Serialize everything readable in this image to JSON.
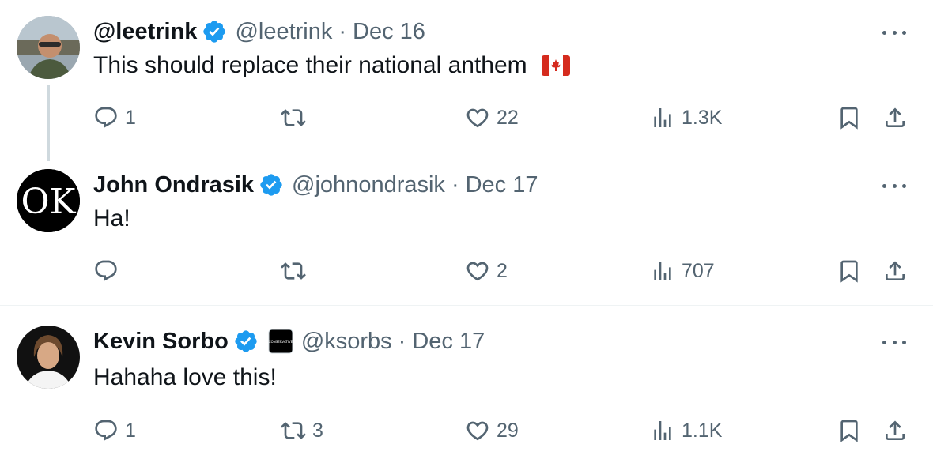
{
  "tweets": [
    {
      "name": "@leetrink",
      "handle": "@leetrink",
      "date": "Dec 16",
      "text": "This should replace their national anthem",
      "flag_icon": "canada-flag-icon",
      "replies": "1",
      "retweets": "",
      "likes": "22",
      "views": "1.3K"
    },
    {
      "name": "John Ondrasik",
      "handle": "@johnondrasik",
      "date": "Dec 17",
      "text": "Ha!",
      "avatar_text": "OK",
      "replies": "",
      "retweets": "",
      "likes": "2",
      "views": "707"
    },
    {
      "name": "Kevin Sorbo",
      "handle": "@ksorbs",
      "date": "Dec 17",
      "text": "Hahaha love this!",
      "affiliate_badge": "CONSERVATIVE",
      "replies": "1",
      "retweets": "3",
      "likes": "29",
      "views": "1.1K"
    }
  ],
  "separator": "·",
  "colors": {
    "verified": "#1d9bf0",
    "muted": "#536471",
    "text": "#0f1419",
    "thread_line": "#cfd9de"
  },
  "icons": {
    "reply": "reply-icon",
    "retweet": "retweet-icon",
    "like": "heart-icon",
    "views": "views-icon",
    "bookmark": "bookmark-icon",
    "share": "share-icon",
    "more": "more-icon",
    "verified": "verified-badge-icon"
  }
}
